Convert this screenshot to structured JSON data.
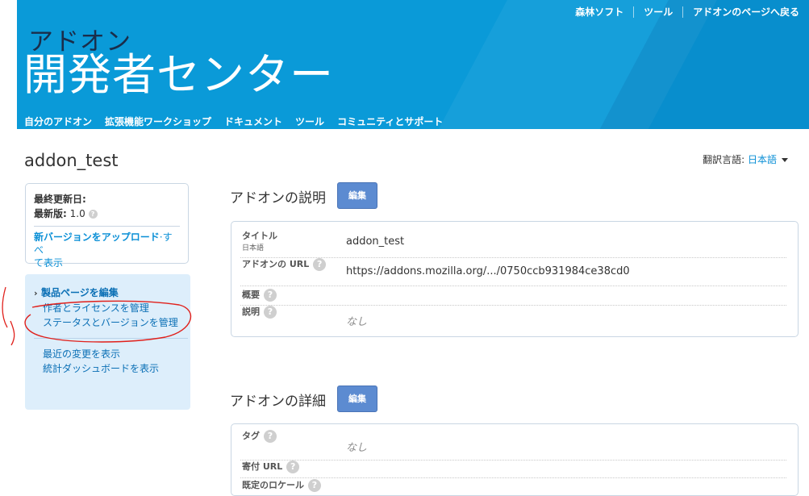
{
  "header": {
    "top_nav": [
      "森林ソフト",
      "ツール",
      "アドオンのページへ戻る"
    ],
    "title_small": "アドオン",
    "title_big": "開発者センター",
    "main_nav": [
      "自分のアドオン",
      "拡張機能ワークショップ",
      "ドキュメント",
      "ツール",
      "コミュニティとサポート"
    ]
  },
  "addon_name": "addon_test",
  "language": {
    "label": "翻訳言語:",
    "value": "日本語"
  },
  "info_box": {
    "last_updated": "最終更新日:",
    "latest_label": "最新版:",
    "latest_value": "1.0",
    "upload_link": "新バージョンをアップロード",
    "separator": "·",
    "view_all_1": "すべ",
    "view_all_2": "て表示"
  },
  "side_menu": {
    "items": [
      "製品ページを編集",
      "作者とライセンスを管理",
      "ステータスとバージョンを管理"
    ],
    "extra": [
      "最近の変更を表示",
      "統計ダッシュボードを表示"
    ]
  },
  "description_section": {
    "title": "アドオンの説明",
    "edit": "編集",
    "rows": [
      {
        "key": "タイトル",
        "sub": "日本語",
        "value": "addon_test"
      },
      {
        "key": "アドオンの URL",
        "value": "https://addons.mozilla.org/.../0750ccb931984ce38cd0"
      },
      {
        "key": "概要",
        "value": ""
      },
      {
        "key": "説明",
        "value": "なし"
      }
    ]
  },
  "details_section": {
    "title": "アドオンの詳細",
    "edit": "編集",
    "rows": [
      {
        "key": "タグ",
        "value": "なし"
      },
      {
        "key": "寄付 URL",
        "value": ""
      },
      {
        "key": "既定のロケール",
        "value": ""
      }
    ]
  },
  "colors": {
    "banner": "#0a9ad8",
    "link": "#0a8fd6",
    "button": "#5c8bd1",
    "annotation": "#e0201b"
  }
}
